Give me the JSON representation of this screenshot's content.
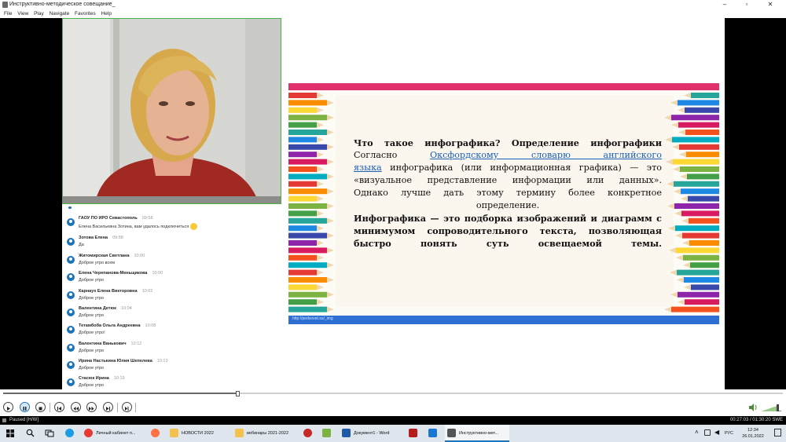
{
  "window": {
    "title": "Инструктивно-методическое совещание_",
    "minimize": "–",
    "maximize": "▫",
    "close": "✕"
  },
  "menu": [
    "File",
    "View",
    "Play",
    "Navigate",
    "Favorites",
    "Help"
  ],
  "chat": [
    {
      "name": "ГАОУ ПО ИРО Севастополь",
      "time": "09:58",
      "text": "Елена Васильевна Зотина, вам удалось подключиться"
    },
    {
      "name": "Зотова Елена",
      "time": "09:58",
      "text": "Да"
    },
    {
      "name": "Житомирская Светлана",
      "time": "10:00",
      "text": "Доброе утро всем"
    },
    {
      "name": "Елена Черепанова-Меньщикова",
      "time": "10:00",
      "text": "Доброе утро"
    },
    {
      "name": "Карнаух Елена Викторовна",
      "time": "10:02",
      "text": "Доброе утро"
    },
    {
      "name": "Валентина Детюк",
      "time": "10:04",
      "text": "Доброе утро"
    },
    {
      "name": "Тетамбоба Ольга Андреевна",
      "time": "10:08",
      "text": "Доброе утро!"
    },
    {
      "name": "Валентина Ванькович",
      "time": "10:12",
      "text": "Доброе утро"
    },
    {
      "name": "Ирина Настькина Юлия Шепелева",
      "time": "10:13",
      "text": "Доброе утро"
    },
    {
      "name": "Стасюк Ирина",
      "time": "10:19",
      "text": "Доброе утро"
    }
  ],
  "slide": {
    "heading": "Что такое инфографика? Определение инфографики",
    "p1_prefix": "Согласно",
    "p1_link_1": "Оксфордскому словарю английского",
    "p1_link_2": "языка",
    "p1_rest_1": "инфографика (или информационная графика) — это",
    "p1_rest_2": "«визуальное представление информации или данных».",
    "p1_rest_3": "Однако лучше дать этому термину более конкретное",
    "p1_rest_4": "определение.",
    "p2_1": "Инфографика — это подборка изображений и диаграмм с",
    "p2_2": "минимумом сопроводительного текста, позволяющая",
    "p2_3": "быстро понять суть освещаемой темы.",
    "footer": "http://pedsovet.su/_img"
  },
  "player": {
    "progress": 0.3,
    "volume": 0.8,
    "status_left": "Paused [H/W]",
    "status_right": "00:27:03 / 01:30:20  SWE"
  },
  "taskbar": {
    "apps": [
      {
        "label": "Личный кабинет п...",
        "color": "#e53935"
      },
      {
        "label": "",
        "color": "#ff7043"
      },
      {
        "label": "НОВОСТИ 2022",
        "color": "#f2c14e"
      },
      {
        "label": "вебинары 2021-2022",
        "color": "#f2c14e"
      },
      {
        "label": "",
        "color": "#c62828"
      },
      {
        "label": "",
        "color": "#7cb342"
      },
      {
        "label": "Документ1 - Word",
        "color": "#1e5aa8"
      },
      {
        "label": "",
        "color": "#b71c1c"
      },
      {
        "label": "",
        "color": "#1976d2"
      },
      {
        "label": "Инструктивно-мет...",
        "color": "#555555"
      }
    ],
    "lang": "РУС",
    "time": "12:34",
    "date": "26.01.2022"
  }
}
